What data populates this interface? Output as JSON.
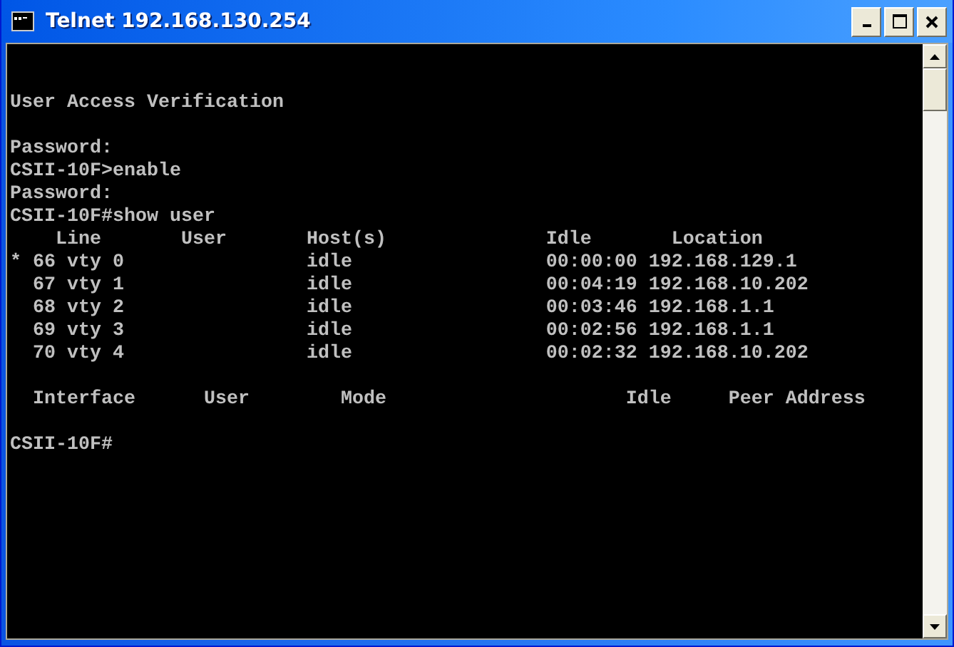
{
  "window": {
    "title": "Telnet 192.168.130.254"
  },
  "terminal": {
    "blocks": [
      [
        "User Access Verification"
      ],
      [
        "Password:",
        "CSII-10F>enable",
        "Password:",
        "CSII-10F#show user",
        "    Line       User       Host(s)              Idle       Location",
        "* 66 vty 0                idle                 00:00:00 192.168.129.1",
        "  67 vty 1                idle                 00:04:19 192.168.10.202",
        "  68 vty 2                idle                 00:03:46 192.168.1.1",
        "  69 vty 3                idle                 00:02:56 192.168.1.1",
        "  70 vty 4                idle                 00:02:32 192.168.10.202"
      ],
      [
        "  Interface      User        Mode                     Idle     Peer Address"
      ],
      [
        "CSII-10F#"
      ]
    ]
  }
}
